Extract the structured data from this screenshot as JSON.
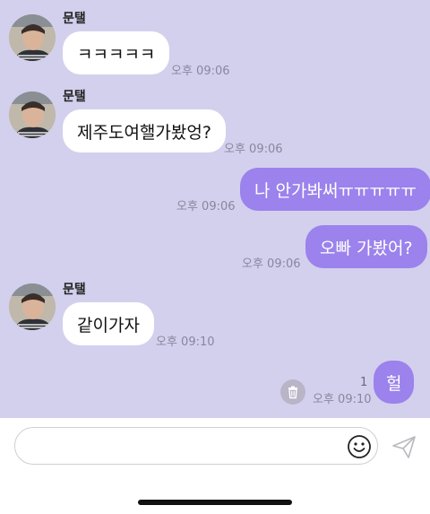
{
  "messages": [
    {
      "sender": "문탤",
      "text": "ㅋㅋㅋㅋㅋ",
      "time": "오후 09:06"
    },
    {
      "sender": "문탤",
      "text": "제주도여핼가봤엉?",
      "time": "오후 09:06"
    },
    {
      "text": "나 안가봐써ㅠㅠㅠㅠㅠ",
      "time": "오후 09:06"
    },
    {
      "text": "오빠 가봤어?",
      "time": "오후 09:06"
    },
    {
      "sender": "문탤",
      "text": "같이가자",
      "time": "오후 09:10"
    },
    {
      "text": "헐",
      "time": "오후 09:10",
      "unread": "1"
    }
  ],
  "icons": {
    "delete": "trash-icon",
    "emoji": "smiley-icon",
    "send": "paper-plane-icon"
  },
  "colors": {
    "chat_background": "#d3d0ee",
    "outgoing_bubble": "#9b82ec",
    "incoming_bubble": "#ffffff"
  }
}
